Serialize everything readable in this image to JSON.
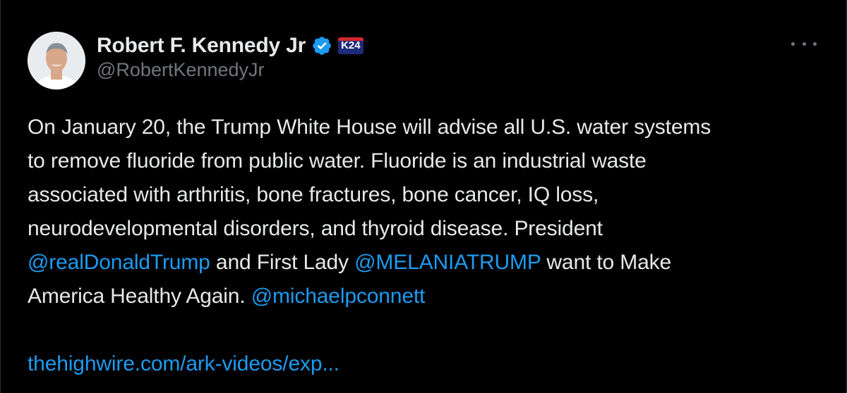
{
  "author": {
    "display_name": "Robert F. Kennedy Jr",
    "handle": "@RobertKennedyJr",
    "badge_text": "K24",
    "verified_color": "#1d9bf0"
  },
  "tweet": {
    "line1": "On January 20, the Trump White House will advise all U.S. water systems",
    "line2": "to remove fluoride from public water. Fluoride is an industrial waste",
    "line3": "associated with arthritis, bone fractures, bone cancer, IQ loss,",
    "line4": "neurodevelopmental disorders, and thyroid disease. President",
    "mention1": "@realDonaldTrump",
    "line5_mid": " and First Lady ",
    "mention2": "@MELANIATRUMP",
    "line5_end": " want to Make",
    "line6_start": "America Healthy Again. ",
    "mention3": "@michaelpconnett",
    "link": "thehighwire.com/ark-videos/exp..."
  },
  "colors": {
    "background": "#000000",
    "text": "#e7e9ea",
    "secondary": "#71767b",
    "accent": "#1d9bf0"
  },
  "icons": [
    "verified-badge-icon",
    "more-options-icon"
  ]
}
